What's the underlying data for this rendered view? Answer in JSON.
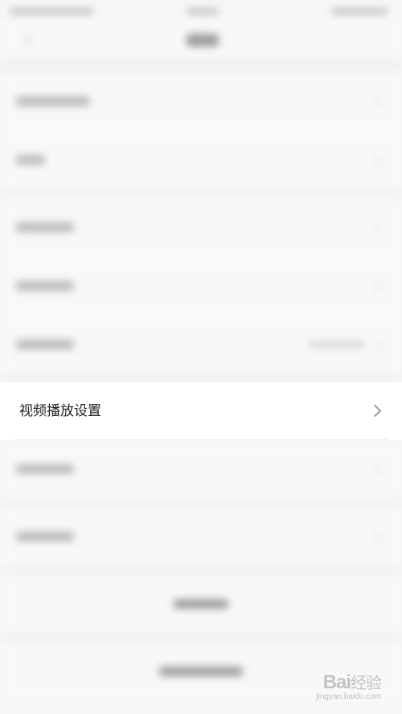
{
  "settings": {
    "video_playback_label": "视频播放设置"
  },
  "watermark": {
    "brand": "Bai",
    "brand_cn": "经验",
    "url": "jingyan.baidu.com"
  }
}
